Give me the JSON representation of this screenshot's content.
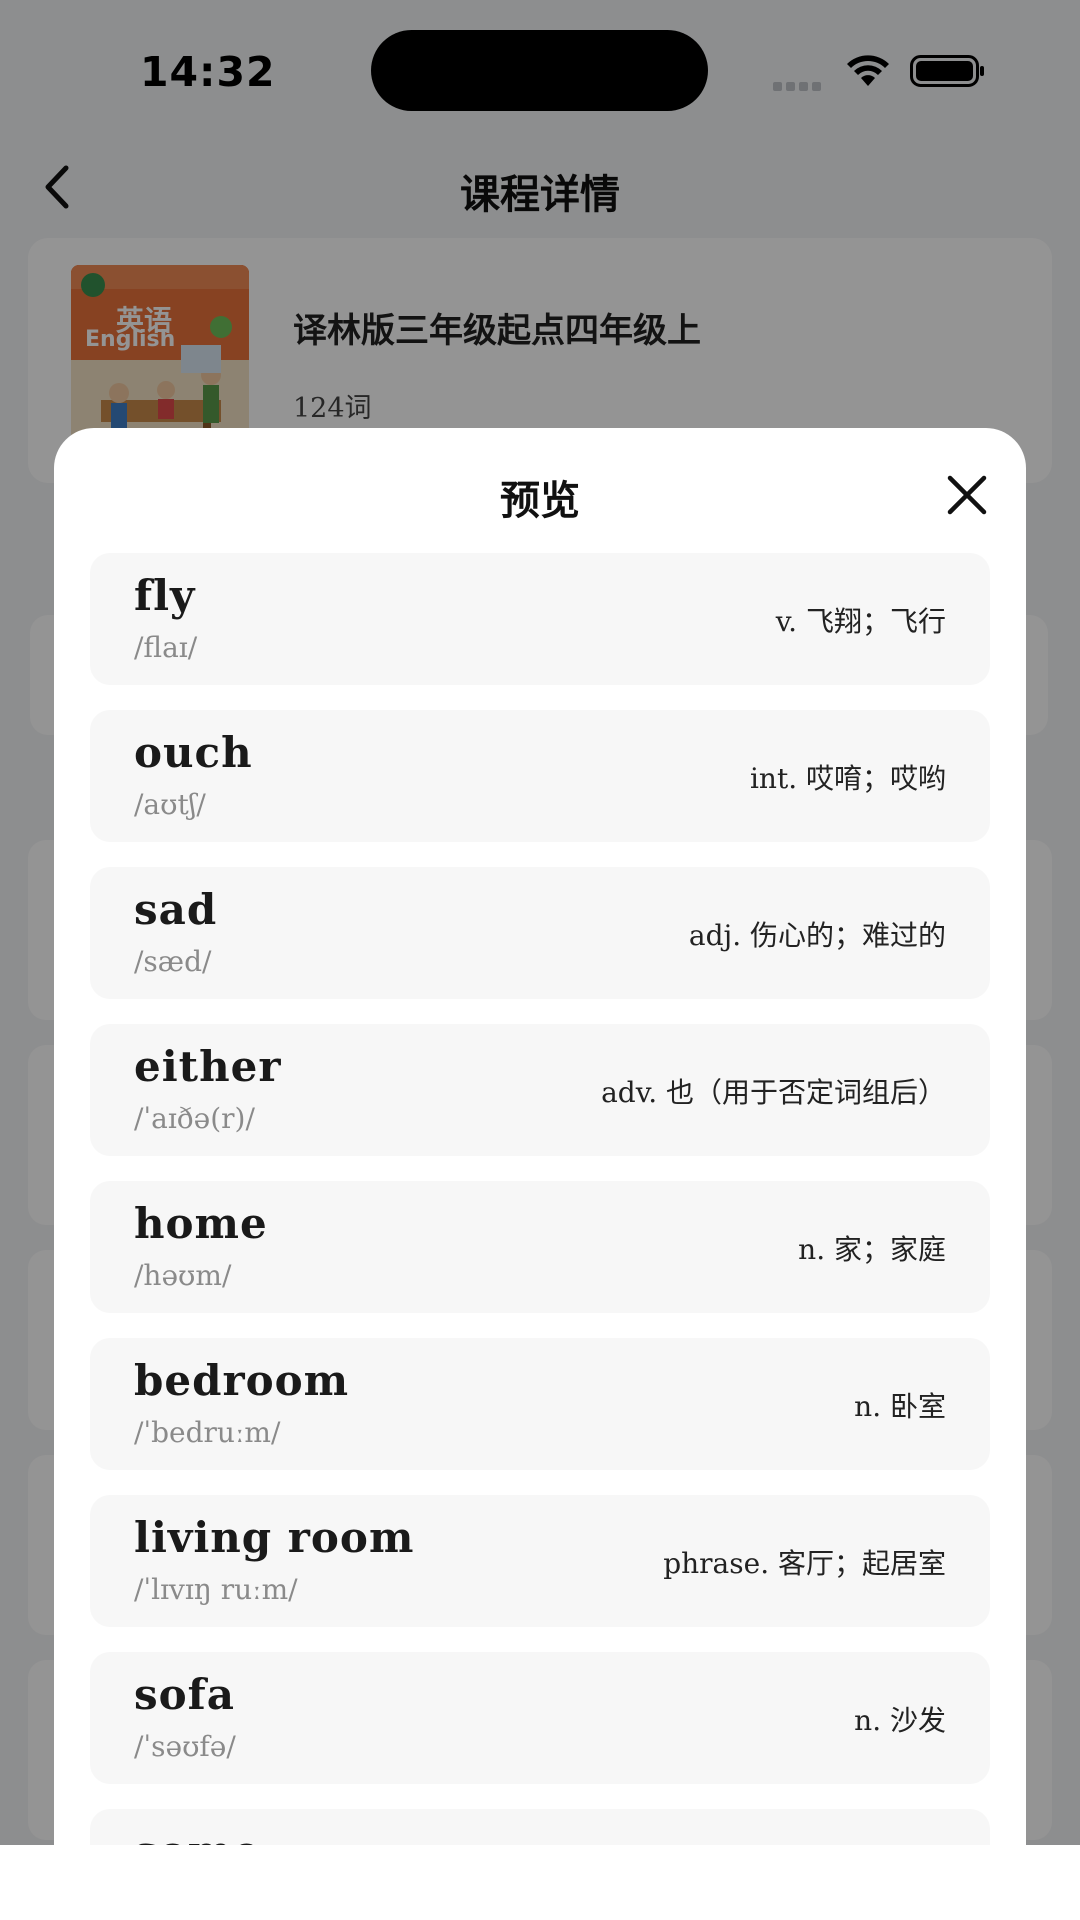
{
  "status_bar": {
    "time": "14:32"
  },
  "nav": {
    "title": "课程详情"
  },
  "course": {
    "cover_title_cn": "英语",
    "cover_title_en": "English",
    "name": "译林版三年级起点四年级上",
    "word_count": "124词"
  },
  "modal": {
    "title": "预览",
    "words": [
      {
        "word": "fly",
        "phonetic": "/flaɪ/",
        "meaning": "v. 飞翔；飞行"
      },
      {
        "word": "ouch",
        "phonetic": "/aʊtʃ/",
        "meaning": "int. 哎唷；哎哟"
      },
      {
        "word": "sad",
        "phonetic": "/sæd/",
        "meaning": "adj. 伤心的；难过的"
      },
      {
        "word": "either",
        "phonetic": "/ˈaɪðə(r)/",
        "meaning": "adv. 也（用于否定词组后）"
      },
      {
        "word": "home",
        "phonetic": "/həʊm/",
        "meaning": "n. 家；家庭"
      },
      {
        "word": "bedroom",
        "phonetic": "/ˈbedruːm/",
        "meaning": "n. 卧室"
      },
      {
        "word": "living room",
        "phonetic": "/ˈlɪvɪŋ ruːm/",
        "meaning": "phrase. 客厅；起居室"
      },
      {
        "word": "sofa",
        "phonetic": "/ˈsəʊfə/",
        "meaning": "n. 沙发"
      },
      {
        "word": "some",
        "phonetic": "",
        "meaning": ""
      }
    ]
  }
}
